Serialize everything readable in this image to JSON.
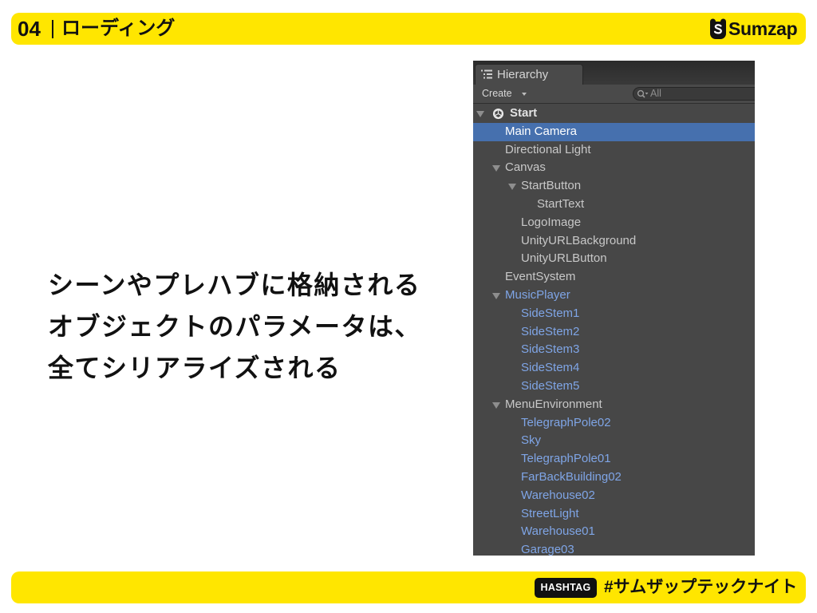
{
  "header": {
    "section_number": "04",
    "section_title": "ローディング",
    "logo_text": "Sumzap",
    "logo_icon": "sumzap-bear-icon"
  },
  "main": {
    "lines": [
      "シーンやプレハブに格納される",
      "オブジェクトのパラメータは、",
      "全てシリアライズされる"
    ]
  },
  "hierarchy": {
    "tab_label": "Hierarchy",
    "tab_icon": "list-icon",
    "create_label": "Create",
    "create_icon": "dropdown-arrow-icon",
    "search_icon": "search-icon",
    "search_value": "All",
    "items": [
      {
        "label": "Start",
        "depth": 0,
        "expanded": true,
        "scene": true
      },
      {
        "label": "Main Camera",
        "depth": 1,
        "selected": true
      },
      {
        "label": "Directional Light",
        "depth": 1
      },
      {
        "label": "Canvas",
        "depth": 1,
        "expanded": true
      },
      {
        "label": "StartButton",
        "depth": 2,
        "expanded": true
      },
      {
        "label": "StartText",
        "depth": 3
      },
      {
        "label": "LogoImage",
        "depth": 2
      },
      {
        "label": "UnityURLBackground",
        "depth": 2
      },
      {
        "label": "UnityURLButton",
        "depth": 2
      },
      {
        "label": "EventSystem",
        "depth": 1
      },
      {
        "label": "MusicPlayer",
        "depth": 1,
        "expanded": true,
        "prefab": true
      },
      {
        "label": "SideStem1",
        "depth": 2,
        "prefab": true
      },
      {
        "label": "SideStem2",
        "depth": 2,
        "prefab": true
      },
      {
        "label": "SideStem3",
        "depth": 2,
        "prefab": true
      },
      {
        "label": "SideStem4",
        "depth": 2,
        "prefab": true
      },
      {
        "label": "SideStem5",
        "depth": 2,
        "prefab": true
      },
      {
        "label": "MenuEnvironment",
        "depth": 1,
        "expanded": true
      },
      {
        "label": "TelegraphPole02",
        "depth": 2,
        "prefab": true
      },
      {
        "label": "Sky",
        "depth": 2,
        "prefab": true
      },
      {
        "label": "TelegraphPole01",
        "depth": 2,
        "prefab": true
      },
      {
        "label": "FarBackBuilding02",
        "depth": 2,
        "prefab": true
      },
      {
        "label": "Warehouse02",
        "depth": 2,
        "prefab": true
      },
      {
        "label": "StreetLight",
        "depth": 2,
        "prefab": true
      },
      {
        "label": "Warehouse01",
        "depth": 2,
        "prefab": true
      },
      {
        "label": "Garage03",
        "depth": 2,
        "prefab": true
      }
    ]
  },
  "footer": {
    "badge": "HASHTAG",
    "hashtag": "#サムザップテックナイト"
  },
  "colors": {
    "slide_background": "#ffffff",
    "accent_yellow": "#ffe600",
    "panel_background": "#474747",
    "selection_blue": "#4670ae",
    "prefab_blue": "#7fa5e6",
    "item_text": "#c8c8c8"
  }
}
